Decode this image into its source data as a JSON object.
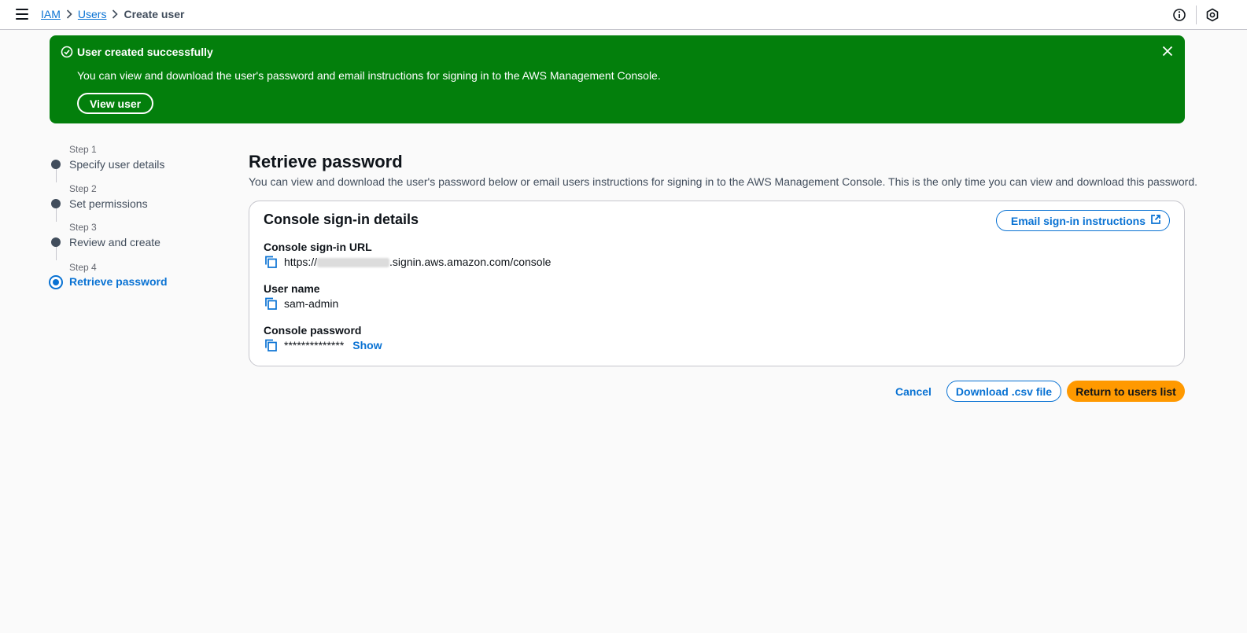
{
  "header": {
    "menu_icon": "hamburger-icon",
    "breadcrumbs": [
      {
        "label": "IAM"
      },
      {
        "label": "Users"
      },
      {
        "label": "Create user"
      }
    ],
    "info_icon": "info-icon",
    "settings_icon": "settings-icon"
  },
  "flash": {
    "icon": "success-check-icon",
    "title": "User created successfully",
    "message": "You can view and download the user's password and email instructions for signing in to the AWS Management Console.",
    "button_label": "View user",
    "close_icon": "close-icon",
    "color": "#037f0c"
  },
  "steps": [
    {
      "number": "Step 1",
      "title": "Specify user details",
      "active": false
    },
    {
      "number": "Step 2",
      "title": "Set permissions",
      "active": false
    },
    {
      "number": "Step 3",
      "title": "Review and create",
      "active": false
    },
    {
      "number": "Step 4",
      "title": "Retrieve password",
      "active": true
    }
  ],
  "main": {
    "title": "Retrieve password",
    "description": "You can view and download the user's password below or email users instructions for signing in to the AWS Management Console. This is the only time you can view and download this password.",
    "card": {
      "title": "Console sign-in details",
      "email_button_label": "Email sign-in instructions",
      "fields": {
        "url": {
          "label": "Console sign-in URL",
          "prefix": "https://",
          "suffix": ".signin.aws.amazon.com/console"
        },
        "username": {
          "label": "User name",
          "value": "sam-admin"
        },
        "password": {
          "label": "Console password",
          "value": "**************",
          "show_label": "Show"
        }
      }
    }
  },
  "actions": {
    "cancel_label": "Cancel",
    "download_label": "Download .csv file",
    "primary_label": "Return to users list"
  },
  "colors": {
    "accent": "#0972d3",
    "primary_button": "#ff9900",
    "success": "#037f0c"
  }
}
